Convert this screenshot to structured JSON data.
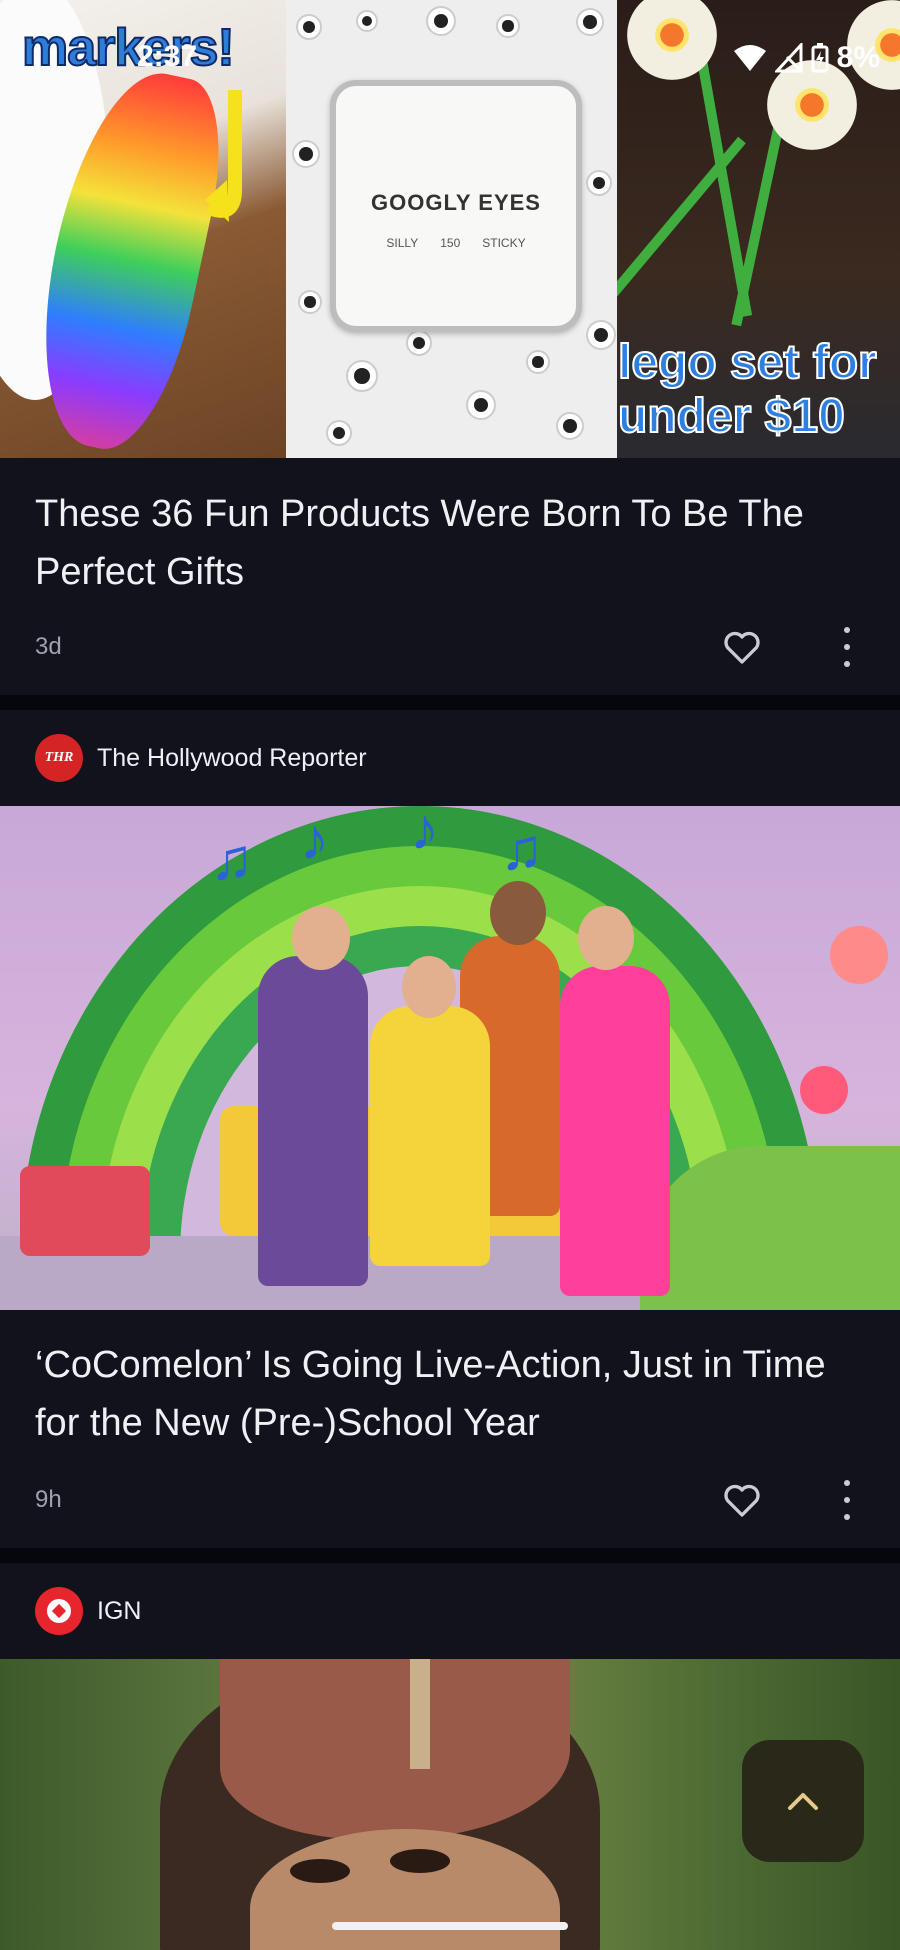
{
  "status_bar": {
    "time": "2:37",
    "battery": "8%"
  },
  "articles": [
    {
      "image_captions": {
        "left": "markers!",
        "right": "lego set for under $10"
      },
      "googly_box": {
        "title": "GOOGLY EYES",
        "left_label": "SILLY",
        "count": "150",
        "right_label": "STICKY"
      },
      "title": "These 36 Fun Products Were Born To Be The Perfect Gifts",
      "age": "3d"
    },
    {
      "source": {
        "name": "The Hollywood Reporter",
        "logo_text": "THR"
      },
      "title": "‘CoComelon’ Is Going Live-Action, Just in Time for the New (Pre-)School Year",
      "age": "9h"
    },
    {
      "source": {
        "name": "IGN"
      }
    }
  ],
  "icons": {
    "like": "heart-outline-icon",
    "more": "more-vert-icon",
    "scroll_top": "chevron-up-icon",
    "wifi": "wifi-icon",
    "signal": "cell-signal-icon",
    "battery": "battery-charging-icon"
  },
  "colors": {
    "background": "#06070c",
    "card": "#11121c",
    "fab": "#2a2818",
    "fab_icon": "#e8c98a"
  }
}
